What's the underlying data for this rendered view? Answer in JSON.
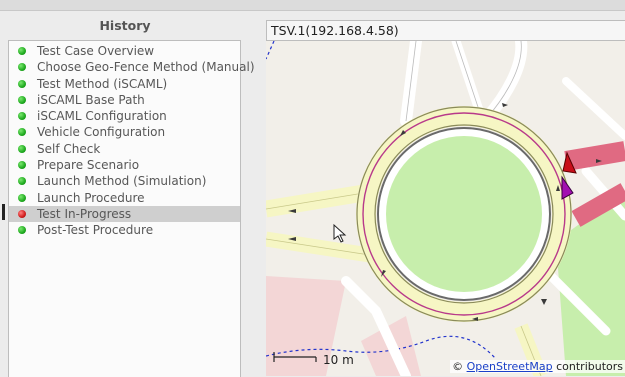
{
  "history": {
    "title": "History",
    "items": [
      {
        "label": "Test Case Overview",
        "status": "green"
      },
      {
        "label": "Choose Geo-Fence Method (Manual)",
        "status": "green"
      },
      {
        "label": "Test Method (iSCAML)",
        "status": "green"
      },
      {
        "label": "iSCAML Base Path",
        "status": "green"
      },
      {
        "label": "iSCAML Configuration",
        "status": "green"
      },
      {
        "label": "Vehicle Configuration",
        "status": "green"
      },
      {
        "label": "Self Check",
        "status": "green"
      },
      {
        "label": "Prepare Scenario",
        "status": "green"
      },
      {
        "label": "Launch Method (Simulation)",
        "status": "green"
      },
      {
        "label": "Launch Procedure",
        "status": "green"
      },
      {
        "label": "Test In-Progress",
        "status": "red",
        "selected": true
      },
      {
        "label": "Post-Test Procedure",
        "status": "green"
      }
    ]
  },
  "map": {
    "title": "TSV.1(192.168.4.58)",
    "scale_label": "10 m",
    "attribution_prefix": "© ",
    "attribution_link": "OpenStreetMap",
    "attribution_suffix": " contributors"
  },
  "colors": {
    "status_green": "#1faa1f",
    "status_red": "#d01c1c",
    "vehicle_red": "#c80e1a",
    "vehicle_purple": "#a20fb0",
    "road_fill": "#f6f6c4",
    "green_area": "#c7eeac",
    "pink_area": "#f3d6d6",
    "route_pink": "#e06a82"
  }
}
